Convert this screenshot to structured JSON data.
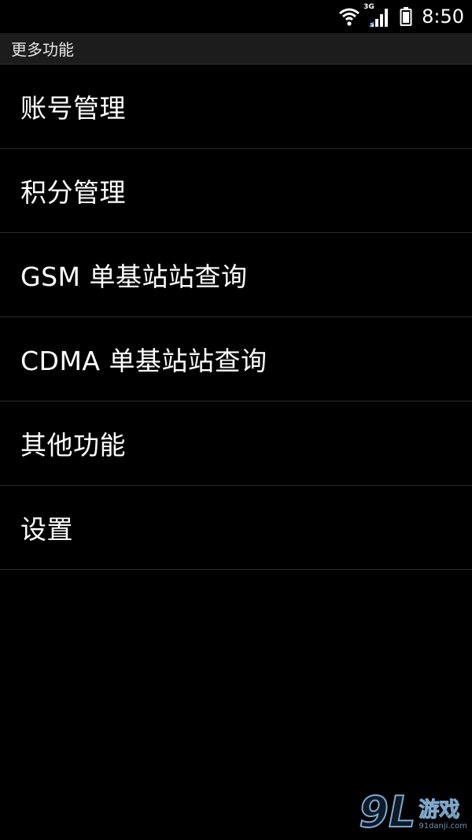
{
  "status_bar": {
    "network_type": "3G",
    "time": "8:50",
    "icons": [
      "wifi-icon",
      "cellular-signal-icon",
      "battery-icon"
    ]
  },
  "header": {
    "title": "更多功能"
  },
  "menu": {
    "items": [
      {
        "label": "账号管理"
      },
      {
        "label": "积分管理"
      },
      {
        "label": "GSM 单基站站查询"
      },
      {
        "label": "CDMA 单基站站查询"
      },
      {
        "label": "其他功能"
      },
      {
        "label": "设置"
      }
    ]
  },
  "watermark": {
    "logo": "9L",
    "brand": "游戏",
    "url": "91danji.com"
  },
  "colors": {
    "background": "#000000",
    "title_bar": "#1c1c1c",
    "divider": "#2a2a2a",
    "text": "#ffffff"
  }
}
